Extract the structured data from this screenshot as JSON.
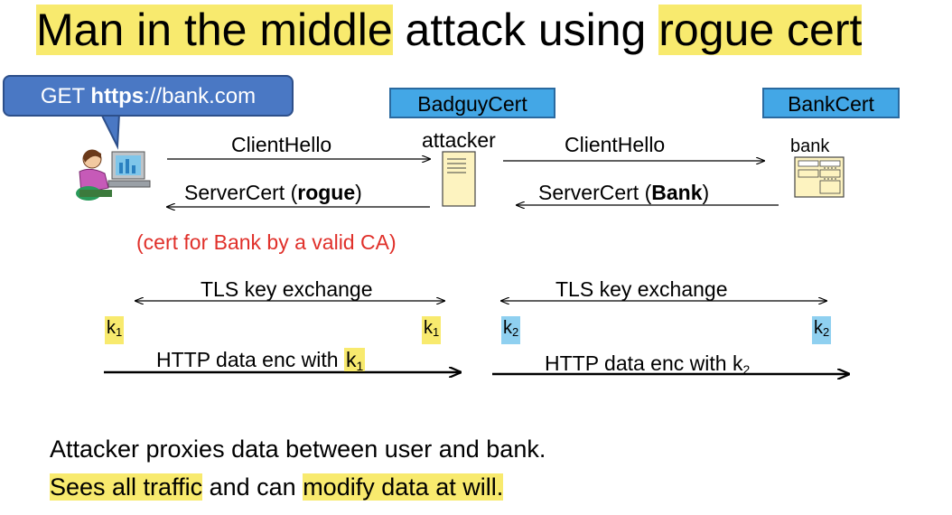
{
  "title": {
    "part1": "Man in the middle",
    "part2": " attack using ",
    "part3": "rogue cert"
  },
  "bubble": {
    "prefix": "GET ",
    "bold": "https",
    "suffix": "://bank.com"
  },
  "certs": {
    "badguy": "BadguyCert",
    "bank": "BankCert"
  },
  "nodes": {
    "attacker": "attacker",
    "bank": "bank"
  },
  "messages": {
    "client_hello_left": "ClientHello",
    "client_hello_right": "ClientHello",
    "server_cert_left_prefix": "ServerCert (",
    "server_cert_left_bold": "rogue",
    "server_cert_left_suffix": ")",
    "server_cert_right_prefix": "ServerCert (",
    "server_cert_right_bold": "Bank",
    "server_cert_right_suffix": ")",
    "rogue_note": "(cert for Bank by a valid CA)"
  },
  "tls": {
    "left": "TLS key exchange",
    "right": "TLS key exchange"
  },
  "keys": {
    "k_letter": "k",
    "k1_sub": "1",
    "k2_sub": "2"
  },
  "http": {
    "left_text": "HTTP data enc with ",
    "right_text": "HTTP data enc with k",
    "right_sub": "2"
  },
  "bottom": {
    "line1": "Attacker proxies data between user and bank.",
    "line2_hl1": "Sees all traffic",
    "line2_mid": " and can ",
    "line2_hl2": "modify data at will."
  },
  "colors": {
    "highlight_yellow": "#f8ea6e",
    "highlight_blue": "#8fd0f0",
    "cert_blue": "#43a7e6",
    "bubble_blue": "#4a78c4",
    "note_red": "#e0302a"
  }
}
